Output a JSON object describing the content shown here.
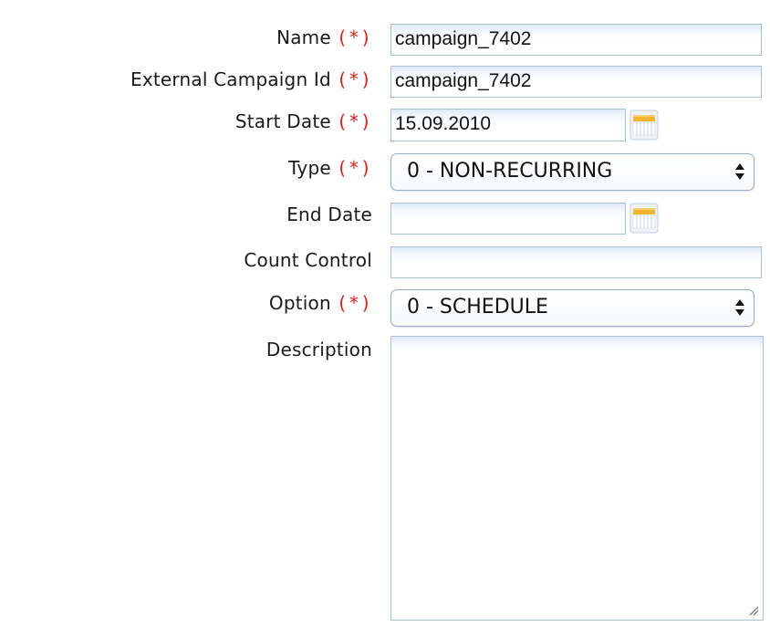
{
  "form": {
    "required_marker": "(*)",
    "name": {
      "label": "Name",
      "value": "campaign_7402"
    },
    "external_id": {
      "label": "External Campaign Id",
      "value": "campaign_7402"
    },
    "start_date": {
      "label": "Start Date",
      "value": "15.09.2010"
    },
    "type": {
      "label": "Type",
      "selected": "0 - NON-RECURRING"
    },
    "end_date": {
      "label": "End Date",
      "value": ""
    },
    "count_control": {
      "label": "Count Control",
      "value": ""
    },
    "option": {
      "label": "Option",
      "selected": "0 - SCHEDULE"
    },
    "description": {
      "label": "Description",
      "value": ""
    }
  },
  "icons": {
    "calendar": "calendar-icon",
    "select_arrows": "select-arrows-icon",
    "resize_grip": "resize-grip-icon"
  },
  "colors": {
    "required": "#e8201a",
    "field_border": "#a9bfd6",
    "calendar_header": "#f2b530"
  }
}
